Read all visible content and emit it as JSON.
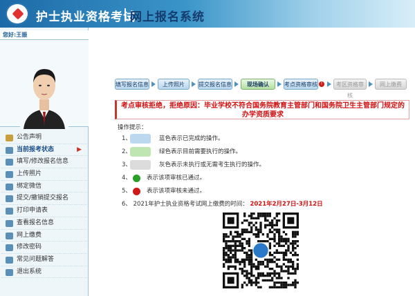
{
  "banner": {
    "title": "护士执业资格考试",
    "subtitle": "网上报名系统"
  },
  "user": {
    "greeting": "您好:王振"
  },
  "menu": [
    {
      "label": "公告声明",
      "icon": "house-icon",
      "active": false
    },
    {
      "label": "当前报考状态",
      "icon": "doc-icon",
      "active": true
    },
    {
      "label": "填写/修改报名信息",
      "icon": "edit-icon",
      "active": false
    },
    {
      "label": "上传照片",
      "icon": "photo-icon",
      "active": false
    },
    {
      "label": "绑定微信",
      "icon": "wechat-icon",
      "active": false
    },
    {
      "label": "提交/撤销提交报名",
      "icon": "submit-icon",
      "active": false
    },
    {
      "label": "打印申请表",
      "icon": "print-icon",
      "active": false
    },
    {
      "label": "查看报名信息",
      "icon": "view-icon",
      "active": false
    },
    {
      "label": "网上缴费",
      "icon": "pay-icon",
      "active": false
    },
    {
      "label": "修改密码",
      "icon": "key-icon",
      "active": false
    },
    {
      "label": "常见问题解答",
      "icon": "help-icon",
      "active": false
    },
    {
      "label": "退出系统",
      "icon": "exit-icon",
      "active": false
    }
  ],
  "steps": [
    {
      "label": "填写报名信息",
      "state": "done"
    },
    {
      "label": "上传照片",
      "state": "done"
    },
    {
      "label": "提交报名信息",
      "state": "done"
    },
    {
      "label": "现场确认",
      "state": "current"
    },
    {
      "label": "考点资格审核",
      "state": "done"
    },
    {
      "label": "考区资格审核",
      "state": "inactive"
    },
    {
      "label": "网上缴费",
      "state": "inactive"
    }
  ],
  "rejection": {
    "line1": "考点审核拒绝，拒绝原因：毕业学校不符合国务院教育主管部门和国务院卫生主管部门规定的",
    "line2": "办学资质要求"
  },
  "tips": {
    "title": "操作提示：",
    "items": [
      {
        "num": "1、",
        "text": "蓝色表示已完成的操作。",
        "swatch": "#bcd8ee"
      },
      {
        "num": "2、",
        "text": "绿色表示目前需要执行的操作。",
        "swatch": "#bfe6b2"
      },
      {
        "num": "3、",
        "text": "灰色表示未执行或无需考生执行的操作。",
        "swatch": "#dcdcdc"
      },
      {
        "num": "4、",
        "text": "表示该项审核已通过。"
      },
      {
        "num": "5、",
        "text": "表示该项审核未通过。"
      }
    ],
    "item6_num": "6、",
    "item6_text": "2021年护士执业资格考试网上缴费的时间：",
    "item6_dates": "2021年2月27日-3月12日"
  },
  "colors": {
    "accent": "#1c6aa8",
    "reject": "#d01010",
    "pass": "#2aa02a"
  }
}
